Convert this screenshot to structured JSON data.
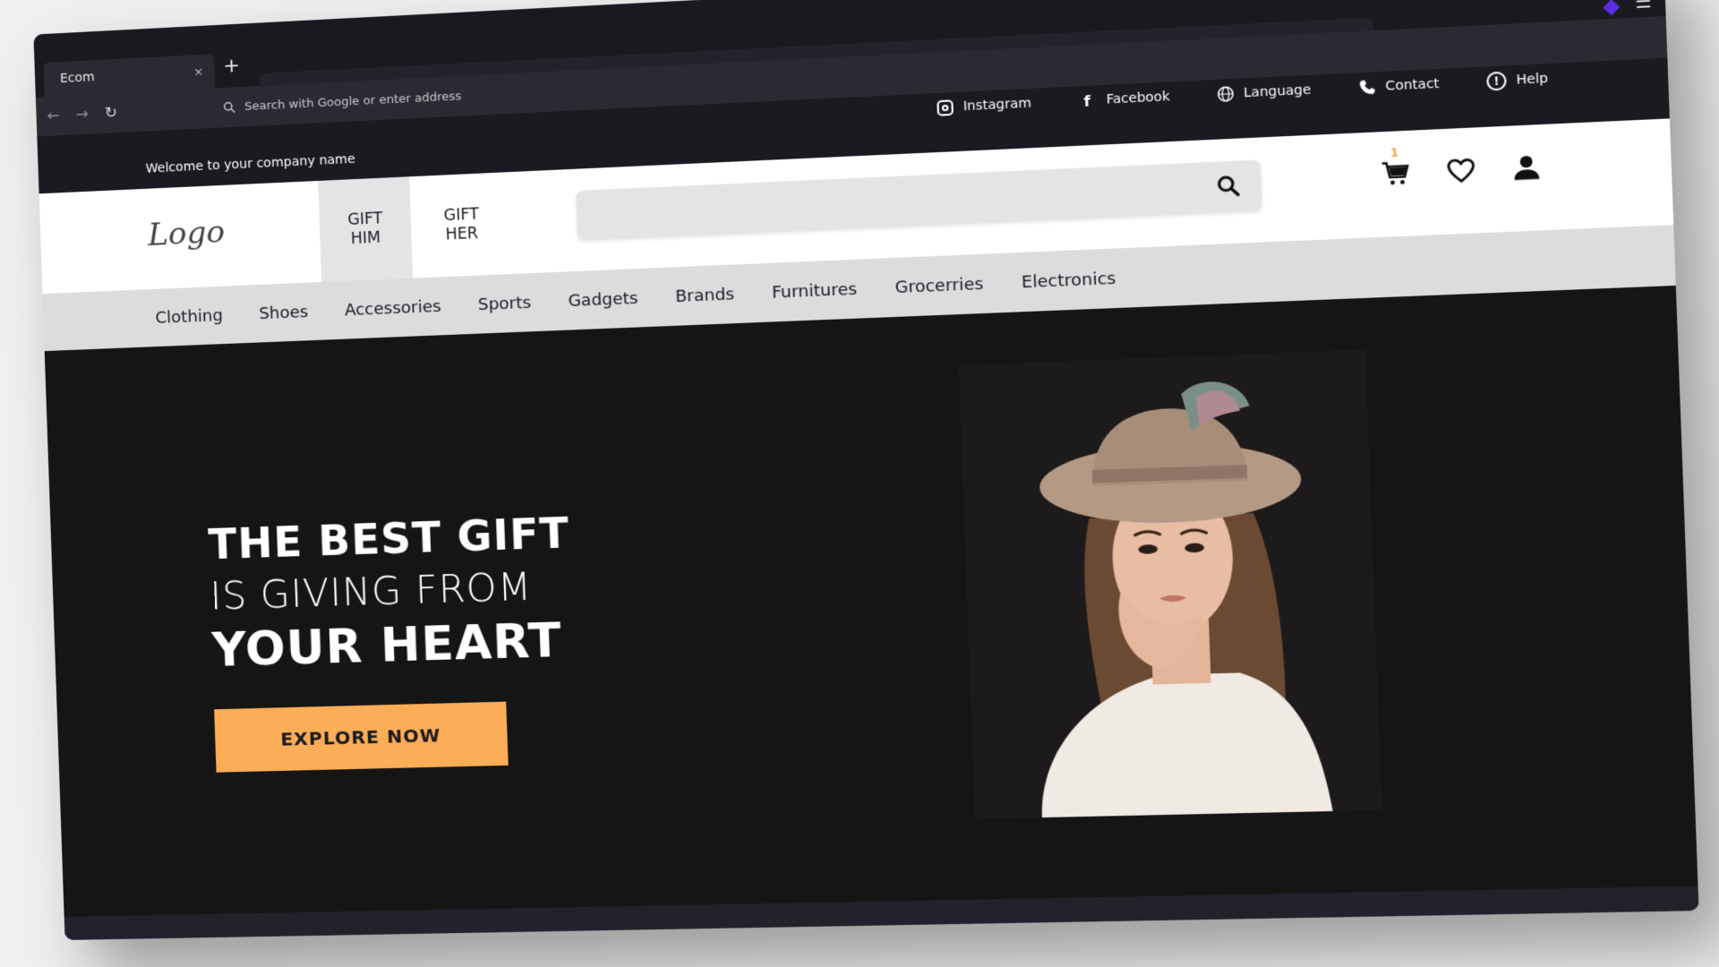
{
  "browser": {
    "tab_title": "Ecom",
    "tab_close": "×",
    "new_tab": "+",
    "address_placeholder": "Search with Google or enter address"
  },
  "site": {
    "welcome": "Welcome to your company name",
    "top_links": {
      "instagram": "Instagram",
      "facebook": "Facebook",
      "language": "Language",
      "contact": "Contact",
      "help": "Help"
    },
    "logo": "Logo",
    "gift_him": "GIFT\nHIM",
    "gift_her": "GIFT\nHER",
    "cart_count": "1",
    "categories": [
      "Clothing",
      "Shoes",
      "Accessories",
      "Sports",
      "Gadgets",
      "Brands",
      "Furnitures",
      "Grocerries",
      "Electronics"
    ],
    "hero": {
      "line1": "THE BEST GIFT",
      "line2": "IS GIVING FROM",
      "line3": "YOUR HEART",
      "cta": "EXPLORE NOW"
    }
  },
  "colors": {
    "accent": "#fbad57",
    "dark": "#161515",
    "cart_badge": "#f4a340"
  }
}
